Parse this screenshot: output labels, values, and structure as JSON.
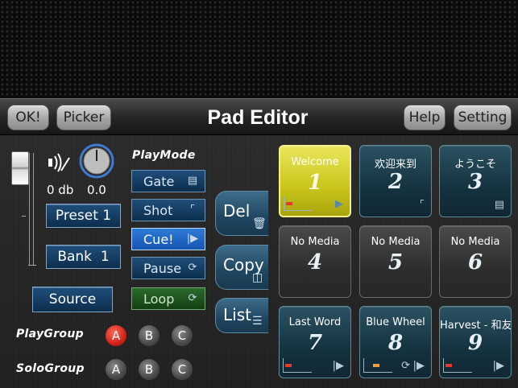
{
  "toolbar": {
    "ok_label": "OK!",
    "picker_label": "Picker",
    "title": "Pad Editor",
    "help_label": "Help",
    "setting_label": "Setting"
  },
  "audio": {
    "volume": "0 db",
    "pan": "0.0"
  },
  "preset": {
    "label": "Preset",
    "value": "1"
  },
  "bank": {
    "label": "Bank",
    "value": "1"
  },
  "source_label": "Source",
  "playmode": {
    "title": "PlayMode",
    "modes": [
      {
        "label": "Gate",
        "icon": "gate-icon"
      },
      {
        "label": "Shot",
        "icon": "gun-icon"
      },
      {
        "label": "Cue!",
        "icon": "cue-play-icon",
        "active": true
      },
      {
        "label": "Pause",
        "icon": "runner-icon"
      },
      {
        "label": "Loop",
        "icon": "loop-icon"
      }
    ]
  },
  "groups": {
    "play_label": "PlayGroup",
    "solo_label": "SoloGroup",
    "options": [
      "A",
      "B",
      "C"
    ],
    "play_selected": "A"
  },
  "actions": {
    "del_label": "Del",
    "copy_label": "Copy",
    "list_label": "List"
  },
  "pads": [
    {
      "name": "Welcome",
      "number": "1",
      "selected": true
    },
    {
      "name": "欢迎来到",
      "number": "2"
    },
    {
      "name": "ようこそ",
      "number": "3"
    },
    {
      "name": "No Media",
      "number": "4"
    },
    {
      "name": "No Media",
      "number": "5"
    },
    {
      "name": "No Media",
      "number": "6"
    },
    {
      "name": "Last Word",
      "number": "7"
    },
    {
      "name": "Blue Wheel",
      "number": "8"
    },
    {
      "name": "Harvest - 和友",
      "number": "9"
    }
  ],
  "colors": {
    "selected_pad": "#c9c51c",
    "pad": "#15323f",
    "empty_pad": "#2e2e2e",
    "active_mode": "#2f7bd8",
    "loop_mode": "#2b6a2b",
    "group_selected": "#d2231a"
  }
}
